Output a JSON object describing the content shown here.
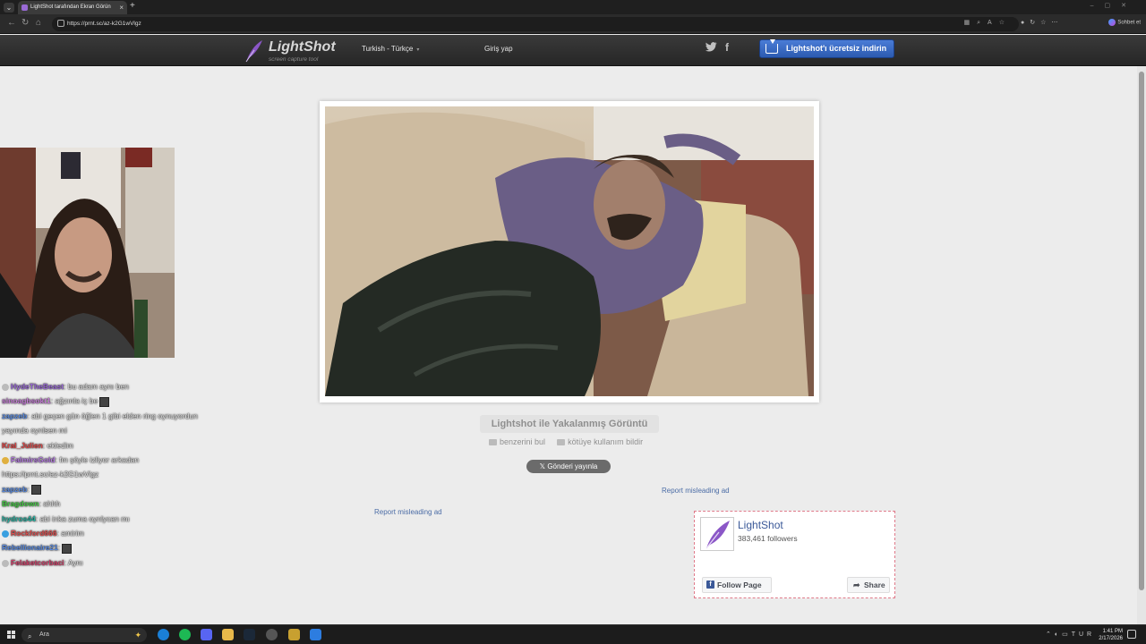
{
  "browser": {
    "tab_title": "LightShot tarafından Ekran Görün",
    "url": "https://prnt.sc/az-k2G1wVlgz",
    "copilot_label": "Sohbet et"
  },
  "header": {
    "logo_name": "LightShot",
    "logo_tagline": "screen capture tool",
    "language": "Turkish - Türkçe",
    "login": "Giriş yap",
    "download_button": "Lightshot'ı ücretsiz indirin"
  },
  "screenshot": {
    "caption": "Lightshot ile Yakalanmış Görüntü",
    "find_similar": "benzerini bul",
    "report_abuse": "kötüye kullanım bildir",
    "tweet_button": "Gönderi yayınla",
    "report_ad_right": "Report misleading ad",
    "report_ad_left": "Report misleading ad"
  },
  "facebook": {
    "page_name": "LightShot",
    "followers": "383,461 followers",
    "follow": "Follow Page",
    "share": "Share"
  },
  "chat": [
    {
      "user": "HydeTheBeast",
      "color": "#9b6bd8",
      "text": ": bu adam aynı ben",
      "badge": "#bbbbbb"
    },
    {
      "user": "sinoagbsokt1",
      "color": "#c77dd8",
      "text": ": ağzınla iç be",
      "badge": ""
    },
    {
      "user": "zapzeb",
      "color": "#5a8be0",
      "text": ": abi geçen gün öğlen 1 gibi elden ring oynuyordun",
      "badge": ""
    },
    {
      "user": "",
      "color": "#e8e8e8",
      "text": "yayında oynlsen mi",
      "badge": ""
    },
    {
      "user": "Kral_Julien",
      "color": "#e04848",
      "text": ": ekledim",
      "badge": ""
    },
    {
      "user": "FalmirsGold",
      "color": "#b57be0",
      "text": ": fm şöyle izliyor arkadan",
      "badge": "#e0b040"
    },
    {
      "user": "",
      "color": "#e8e8e8",
      "text": "https://prnt.sc/az-k2G1wVlgz",
      "badge": ""
    },
    {
      "user": "zapzeb",
      "color": "#5a8be0",
      "text": ":",
      "badge": ""
    },
    {
      "user": "Bragdown",
      "color": "#46c846",
      "text": ": ahhh",
      "badge": ""
    },
    {
      "user": "hydros44",
      "color": "#2ab0a0",
      "text": ": abi inka zuma oynlycan mı",
      "badge": ""
    },
    {
      "user": "Rockford666",
      "color": "#e05050",
      "text": ": amirim",
      "badge": "#3aa0e0"
    },
    {
      "user": "Rebellionaire21",
      "color": "#5a8be0",
      "text": ":",
      "badge": ""
    },
    {
      "user": "Felaketcorbaci",
      "color": "#d0406a",
      "text": ": Aynı",
      "badge": "#bbbbbb"
    }
  ],
  "taskbar": {
    "search_placeholder": "Ara",
    "lang": "TUR",
    "time": "1:41 PM",
    "date": "2/17/2026"
  }
}
